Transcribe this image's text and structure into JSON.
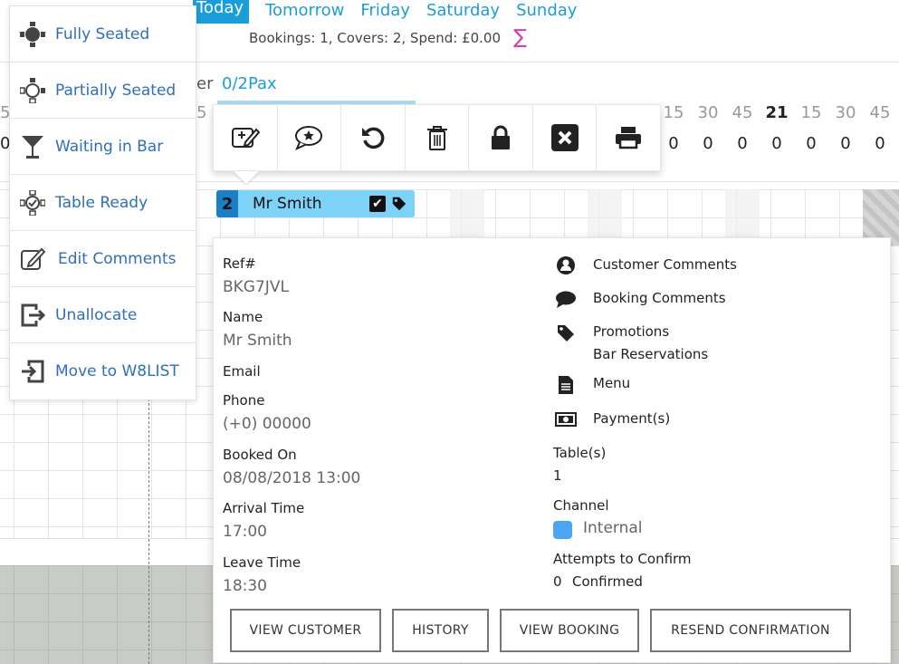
{
  "day_tabs": [
    "Today",
    "Tomorrow",
    "Friday",
    "Saturday",
    "Sunday"
  ],
  "stats": {
    "bookings_label": "Bookings:",
    "bookings": "1",
    "covers_label": ", Covers:",
    "covers": "2",
    "spend_label": ", Spend:",
    "spend": "£0.00",
    "sigma": "∑"
  },
  "table_header": {
    "fragment": "er",
    "pax": "0/2Pax"
  },
  "timeline": {
    "left_minute": "5",
    "left_count": "0",
    "mid_minute": "5",
    "minutes": [
      "15",
      "30",
      "45",
      "21",
      "15",
      "30",
      "45"
    ],
    "counts": [
      "0",
      "0",
      "0",
      "0",
      "0",
      "0",
      "0",
      "0"
    ]
  },
  "booking_bar": {
    "number": "2",
    "name": "Mr Smith"
  },
  "context_menu": [
    {
      "label": "Fully Seated",
      "icon": "fully-seated-icon"
    },
    {
      "label": "Partially Seated",
      "icon": "partially-seated-icon"
    },
    {
      "label": "Waiting in Bar",
      "icon": "cocktail-glass-icon"
    },
    {
      "label": "Table Ready",
      "icon": "table-ready-icon"
    },
    {
      "label": "Edit Comments",
      "icon": "edit-comments-icon"
    },
    {
      "label": "Unallocate",
      "icon": "unallocate-icon"
    },
    {
      "label": "Move to W8LIST",
      "icon": "move-to-waitlist-icon"
    }
  ],
  "toolbar": [
    "edit-booking-icon",
    "comment-star-icon",
    "undo-icon",
    "trash-icon",
    "lock-icon",
    "cancel-x-icon",
    "print-icon"
  ],
  "details": {
    "ref_label": "Ref#",
    "ref": "BKG7JVL",
    "name_label": "Name",
    "name": "Mr Smith",
    "email_label": "Email",
    "phone_label": "Phone",
    "phone": "(+0) 00000",
    "booked_label": "Booked On",
    "booked": "08/08/2018 13:00",
    "arrival_label": "Arrival Time",
    "arrival": "17:00",
    "leave_label": "Leave Time",
    "leave": "18:30",
    "customer_comments": "Customer Comments",
    "booking_comments": "Booking Comments",
    "promotions": "Promotions",
    "promotion_item": "Bar Reservations",
    "menu": "Menu",
    "payments": "Payment(s)",
    "tables_label": "Table(s)",
    "tables": "1",
    "channel_label": "Channel",
    "channel": "Internal",
    "attempts_label": "Attempts to Confirm",
    "attempts": "0",
    "confirmed": "Confirmed"
  },
  "buttons": {
    "view_customer": "VIEW CUSTOMER",
    "history": "HISTORY",
    "view_booking": "VIEW BOOKING",
    "resend": "RESEND CONFIRMATION"
  },
  "colors": {
    "accent": "#1a9ddb",
    "booking_bar": "#7dd3f7",
    "menu_text": "#2d6fbf",
    "sigma": "#d63fb3",
    "channel_internal": "#4aa6f5"
  }
}
